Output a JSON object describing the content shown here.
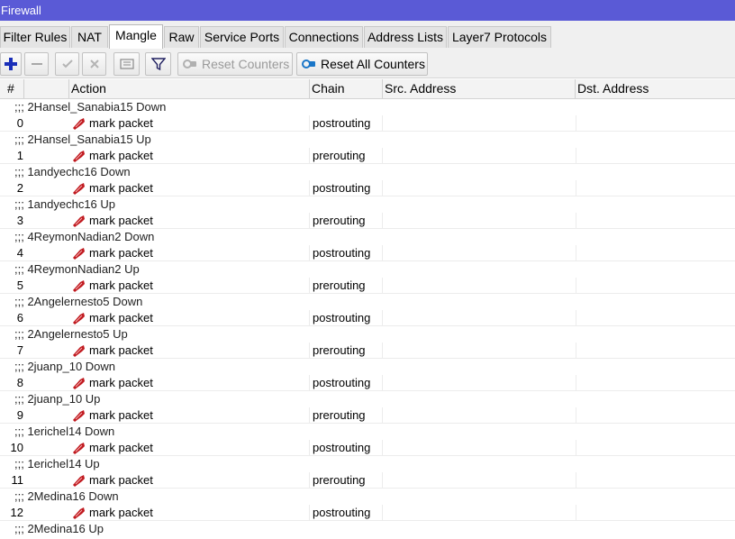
{
  "window": {
    "title": "Firewall"
  },
  "tabs": [
    {
      "label": "Filter Rules",
      "active": false
    },
    {
      "label": "NAT",
      "active": false
    },
    {
      "label": "Mangle",
      "active": true
    },
    {
      "label": "Raw",
      "active": false
    },
    {
      "label": "Service Ports",
      "active": false
    },
    {
      "label": "Connections",
      "active": false
    },
    {
      "label": "Address Lists",
      "active": false
    },
    {
      "label": "Layer7 Protocols",
      "active": false
    }
  ],
  "toolbar": {
    "reset_counters": "Reset Counters",
    "reset_all_counters": "Reset All Counters"
  },
  "columns": [
    "#",
    "",
    "Action",
    "Chain",
    "Src. Address",
    "Dst. Address"
  ],
  "colors": {
    "title_bar": "#5a5ad6",
    "add_icon": "#1a2fb8",
    "mark_icon": "#c0191f",
    "reset_icon": "#1a76c8"
  },
  "rows": [
    {
      "type": "comment",
      "text": ";;; 2Hansel_Sanabia15 Down"
    },
    {
      "type": "rule",
      "num": "0",
      "action": "mark packet",
      "chain": "postrouting"
    },
    {
      "type": "comment",
      "text": ";;; 2Hansel_Sanabia15 Up"
    },
    {
      "type": "rule",
      "num": "1",
      "action": "mark packet",
      "chain": "prerouting"
    },
    {
      "type": "comment",
      "text": ";;; 1andyechc16 Down"
    },
    {
      "type": "rule",
      "num": "2",
      "action": "mark packet",
      "chain": "postrouting"
    },
    {
      "type": "comment",
      "text": ";;; 1andyechc16 Up"
    },
    {
      "type": "rule",
      "num": "3",
      "action": "mark packet",
      "chain": "prerouting"
    },
    {
      "type": "comment",
      "text": ";;; 4ReymonNadian2 Down"
    },
    {
      "type": "rule",
      "num": "4",
      "action": "mark packet",
      "chain": "postrouting"
    },
    {
      "type": "comment",
      "text": ";;; 4ReymonNadian2 Up"
    },
    {
      "type": "rule",
      "num": "5",
      "action": "mark packet",
      "chain": "prerouting"
    },
    {
      "type": "comment",
      "text": ";;; 2Angelernesto5 Down"
    },
    {
      "type": "rule",
      "num": "6",
      "action": "mark packet",
      "chain": "postrouting"
    },
    {
      "type": "comment",
      "text": ";;; 2Angelernesto5 Up"
    },
    {
      "type": "rule",
      "num": "7",
      "action": "mark packet",
      "chain": "prerouting"
    },
    {
      "type": "comment",
      "text": ";;; 2juanp_10 Down"
    },
    {
      "type": "rule",
      "num": "8",
      "action": "mark packet",
      "chain": "postrouting"
    },
    {
      "type": "comment",
      "text": ";;; 2juanp_10 Up"
    },
    {
      "type": "rule",
      "num": "9",
      "action": "mark packet",
      "chain": "prerouting"
    },
    {
      "type": "comment",
      "text": ";;; 1erichel14 Down"
    },
    {
      "type": "rule",
      "num": "10",
      "action": "mark packet",
      "chain": "postrouting"
    },
    {
      "type": "comment",
      "text": ";;; 1erichel14 Up"
    },
    {
      "type": "rule",
      "num": "11",
      "action": "mark packet",
      "chain": "prerouting"
    },
    {
      "type": "comment",
      "text": ";;; 2Medina16 Down"
    },
    {
      "type": "rule",
      "num": "12",
      "action": "mark packet",
      "chain": "postrouting"
    },
    {
      "type": "comment",
      "text": ";;; 2Medina16 Up"
    }
  ]
}
